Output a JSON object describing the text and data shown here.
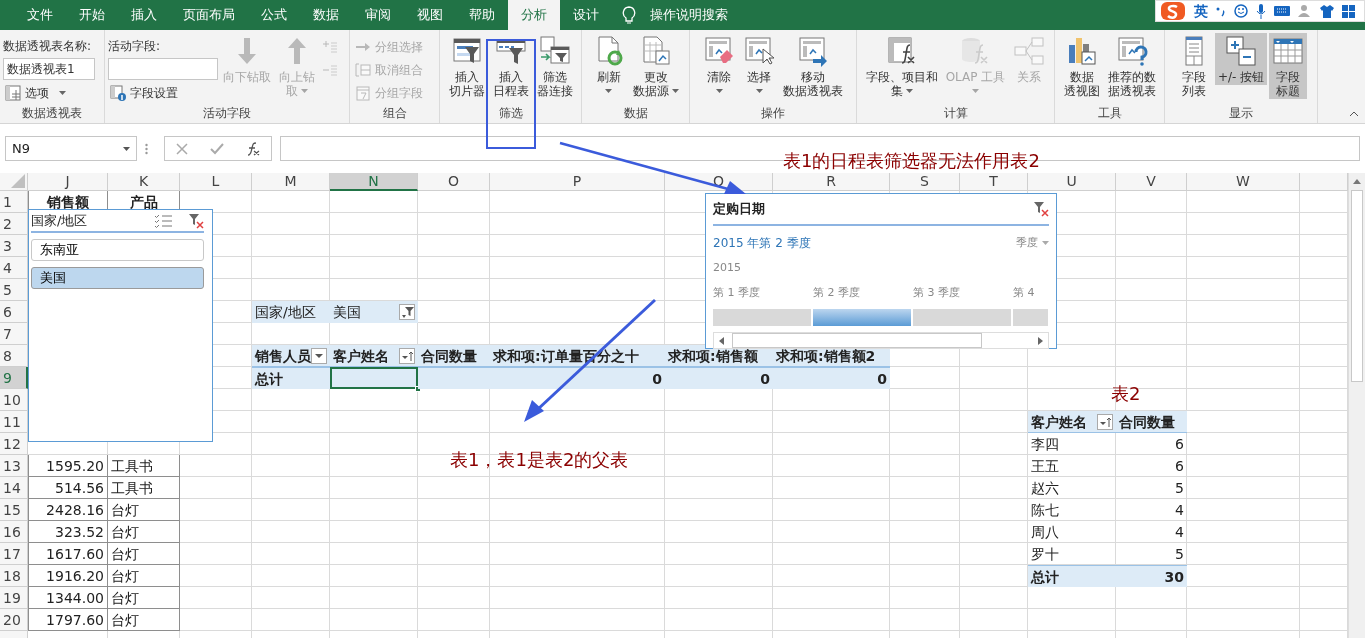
{
  "ribbon_tabs": [
    {
      "label": "文件",
      "selected": false
    },
    {
      "label": "开始",
      "selected": false
    },
    {
      "label": "插入",
      "selected": false
    },
    {
      "label": "页面布局",
      "selected": false
    },
    {
      "label": "公式",
      "selected": false
    },
    {
      "label": "数据",
      "selected": false
    },
    {
      "label": "审阅",
      "selected": false
    },
    {
      "label": "视图",
      "selected": false
    },
    {
      "label": "帮助",
      "selected": false
    },
    {
      "label": "分析",
      "selected": true
    },
    {
      "label": "设计",
      "selected": false
    }
  ],
  "tell_me": {
    "label": "操作说明搜索"
  },
  "ime_toolbar": {
    "language": "英"
  },
  "ribbon_groups": [
    {
      "label": "数据透视表",
      "columns": [
        {
          "items": [
            {
              "kind": "caption",
              "text": "数据透视表名称:"
            },
            {
              "kind": "field",
              "value": "数据透视表1"
            },
            {
              "kind": "small",
              "label": "选项",
              "dropdown": true,
              "disabled": false
            }
          ]
        }
      ]
    },
    {
      "label": "活动字段",
      "columns": [
        {
          "items": [
            {
              "kind": "caption",
              "text": "活动字段:"
            },
            {
              "kind": "field"
            },
            {
              "kind": "small",
              "label": "字段设置",
              "dropdown": false,
              "disabled": false
            }
          ]
        },
        {
          "items": [
            {
              "kind": "large",
              "lines": [
                "向下钻取"
              ],
              "dropdown": false,
              "disabled": true,
              "pressed": false
            }
          ]
        },
        {
          "items": [
            {
              "kind": "large",
              "lines": [
                "向上钻",
                "取"
              ],
              "dropdown": true,
              "disabled": true,
              "pressed": false
            }
          ]
        },
        {
          "items": [
            {
              "kind": "mini",
              "disabled": true
            },
            {
              "kind": "mini",
              "disabled": true
            }
          ]
        }
      ]
    },
    {
      "label": "组合",
      "columns": [
        {
          "items": [
            {
              "kind": "small",
              "label": "分组选择",
              "dropdown": false,
              "disabled": true
            },
            {
              "kind": "small",
              "label": "取消组合",
              "dropdown": false,
              "disabled": true
            },
            {
              "kind": "small",
              "label": "分组字段",
              "dropdown": false,
              "disabled": true
            }
          ]
        }
      ]
    },
    {
      "label": "筛选",
      "columns": [
        {
          "items": [
            {
              "kind": "large",
              "lines": [
                "插入",
                "切片器"
              ],
              "dropdown": false,
              "disabled": false,
              "pressed": false
            }
          ]
        },
        {
          "items": [
            {
              "kind": "large",
              "lines": [
                "插入",
                "日程表"
              ],
              "dropdown": false,
              "disabled": false,
              "pressed": false
            }
          ]
        },
        {
          "items": [
            {
              "kind": "large",
              "lines": [
                "筛选",
                "器连接"
              ],
              "dropdown": false,
              "disabled": false,
              "pressed": false
            }
          ]
        }
      ]
    },
    {
      "label": "数据",
      "columns": [
        {
          "items": [
            {
              "kind": "large",
              "lines": [
                "刷新"
              ],
              "dropdown": true,
              "disabled": false,
              "pressed": false
            }
          ]
        },
        {
          "items": [
            {
              "kind": "large",
              "lines": [
                "更改",
                "数据源"
              ],
              "dropdown": true,
              "disabled": false,
              "pressed": false
            }
          ]
        }
      ]
    },
    {
      "label": "操作",
      "columns": [
        {
          "items": [
            {
              "kind": "large",
              "lines": [
                "清除"
              ],
              "dropdown": true,
              "disabled": false,
              "pressed": false
            }
          ]
        },
        {
          "items": [
            {
              "kind": "large",
              "lines": [
                "选择"
              ],
              "dropdown": true,
              "disabled": false,
              "pressed": false
            }
          ]
        },
        {
          "items": [
            {
              "kind": "large",
              "lines": [
                "移动",
                "数据透视表"
              ],
              "dropdown": false,
              "disabled": false,
              "pressed": false
            }
          ]
        }
      ]
    },
    {
      "label": "计算",
      "columns": [
        {
          "items": [
            {
              "kind": "large",
              "lines": [
                "字段、项目和",
                "集"
              ],
              "dropdown": true,
              "disabled": false,
              "pressed": false
            }
          ]
        },
        {
          "items": [
            {
              "kind": "large",
              "lines": [
                "OLAP 工具"
              ],
              "dropdown": true,
              "disabled": true,
              "pressed": false
            }
          ]
        },
        {
          "items": [
            {
              "kind": "large",
              "lines": [
                "关系"
              ],
              "dropdown": false,
              "disabled": true,
              "pressed": false
            }
          ]
        }
      ]
    },
    {
      "label": "工具",
      "columns": [
        {
          "items": [
            {
              "kind": "large",
              "lines": [
                "数据",
                "透视图"
              ],
              "dropdown": false,
              "disabled": false,
              "pressed": false
            }
          ]
        },
        {
          "items": [
            {
              "kind": "large",
              "lines": [
                "推荐的数",
                "据透视表"
              ],
              "dropdown": false,
              "disabled": false,
              "pressed": false
            }
          ]
        }
      ]
    },
    {
      "label": "显示",
      "columns": [
        {
          "items": [
            {
              "kind": "large",
              "lines": [
                "字段",
                "列表"
              ],
              "dropdown": false,
              "disabled": false,
              "pressed": false
            }
          ]
        },
        {
          "items": [
            {
              "kind": "large",
              "lines": [
                "+/- 按钮"
              ],
              "dropdown": false,
              "disabled": false,
              "pressed": true
            }
          ]
        },
        {
          "items": [
            {
              "kind": "large",
              "lines": [
                "字段",
                "标题"
              ],
              "dropdown": false,
              "disabled": false,
              "pressed": true
            }
          ]
        }
      ]
    }
  ],
  "formula_bar": {
    "name_box": "N9"
  },
  "sheet": {
    "columns": [
      {
        "label": "J",
        "selected": false
      },
      {
        "label": "K",
        "selected": false
      },
      {
        "label": "L",
        "selected": false
      },
      {
        "label": "M",
        "selected": false
      },
      {
        "label": "N",
        "selected": true
      },
      {
        "label": "O",
        "selected": false
      },
      {
        "label": "P",
        "selected": false
      },
      {
        "label": "Q",
        "selected": false
      },
      {
        "label": "R",
        "selected": false
      },
      {
        "label": "S",
        "selected": false
      },
      {
        "label": "T",
        "selected": false
      },
      {
        "label": "U",
        "selected": false
      },
      {
        "label": "V",
        "selected": false
      },
      {
        "label": "W",
        "selected": false
      }
    ],
    "rows": [
      {
        "label": "1",
        "selected": false
      },
      {
        "label": "2",
        "selected": false
      },
      {
        "label": "3",
        "selected": false
      },
      {
        "label": "4",
        "selected": false
      },
      {
        "label": "5",
        "selected": false
      },
      {
        "label": "6",
        "selected": false
      },
      {
        "label": "7",
        "selected": false
      },
      {
        "label": "8",
        "selected": false
      },
      {
        "label": "9",
        "selected": true
      },
      {
        "label": "10",
        "selected": false
      },
      {
        "label": "11",
        "selected": false
      },
      {
        "label": "12",
        "selected": false
      },
      {
        "label": "13",
        "selected": false
      },
      {
        "label": "14",
        "selected": false
      },
      {
        "label": "15",
        "selected": false
      },
      {
        "label": "16",
        "selected": false
      },
      {
        "label": "17",
        "selected": false
      },
      {
        "label": "18",
        "selected": false
      },
      {
        "label": "19",
        "selected": false
      },
      {
        "label": "20",
        "selected": false
      }
    ]
  },
  "source_table": {
    "header": [
      "销售额",
      "产品"
    ],
    "rows": [
      {
        "cells": [
          "1595.20",
          "工具书"
        ]
      },
      {
        "cells": [
          "514.56",
          "工具书"
        ]
      },
      {
        "cells": [
          "2428.16",
          "台灯"
        ]
      },
      {
        "cells": [
          "323.52",
          "台灯"
        ]
      },
      {
        "cells": [
          "1617.60",
          "台灯"
        ]
      },
      {
        "cells": [
          "1916.20",
          "台灯"
        ]
      },
      {
        "cells": [
          "1344.00",
          "台灯"
        ]
      },
      {
        "cells": [
          "1797.60",
          "台灯"
        ]
      }
    ]
  },
  "pivot_tables": [
    {
      "filter": {
        "field": "国家/地区",
        "value": "美国"
      },
      "header": [
        {
          "text": "销售人员",
          "kind": "dropdown"
        },
        {
          "text": "客户姓名",
          "kind": "sort-filter"
        },
        {
          "text": "合同数量",
          "kind": "plain"
        },
        {
          "text": "求和项:订单量百分之十",
          "kind": "plain"
        },
        {
          "text": "求和项:销售额",
          "kind": "plain"
        },
        {
          "text": "求和项:销售额2",
          "kind": "plain"
        }
      ],
      "total": [
        {
          "text": "总计",
          "selected": false
        },
        {
          "selected": true
        },
        {
          "selected": false
        },
        {
          "text": "0",
          "selected": false
        },
        {
          "text": "0",
          "selected": false
        },
        {
          "text": "0",
          "selected": false
        }
      ]
    },
    {
      "header": [
        {
          "text": "客户姓名",
          "kind": "sort-filter"
        },
        {
          "text": "合同数量",
          "kind": "plain"
        }
      ],
      "rows": [
        {
          "cells": [
            "李四",
            "6"
          ]
        },
        {
          "cells": [
            "王五",
            "6"
          ]
        },
        {
          "cells": [
            "赵六",
            "5"
          ]
        },
        {
          "cells": [
            "陈七",
            "4"
          ]
        },
        {
          "cells": [
            "周八",
            "4"
          ]
        },
        {
          "cells": [
            "罗十",
            "5"
          ]
        }
      ],
      "total": [
        {
          "text": "总计",
          "selected": false
        },
        {
          "text": "30",
          "selected": false
        }
      ]
    }
  ],
  "slicer": {
    "title": "国家/地区",
    "items": [
      {
        "label": "东南亚",
        "selected": false
      },
      {
        "label": "美国",
        "selected": true
      }
    ]
  },
  "timeline": {
    "title": "定购日期",
    "selection": "2015 年第 2 季度",
    "level": "季度",
    "year": "2015",
    "periods": [
      {
        "label": "第 1 季度",
        "selected": false
      },
      {
        "label": "第 2 季度",
        "selected": true
      },
      {
        "label": "第 3 季度",
        "selected": false
      },
      {
        "label": "第 4",
        "selected": false
      }
    ]
  },
  "annotations": [
    {
      "kind": "note",
      "text": "表1的日程表筛选器无法作用表2"
    },
    {
      "kind": "note",
      "text": "表1，表1是表2的父表"
    },
    {
      "kind": "note",
      "text": "表2"
    }
  ]
}
